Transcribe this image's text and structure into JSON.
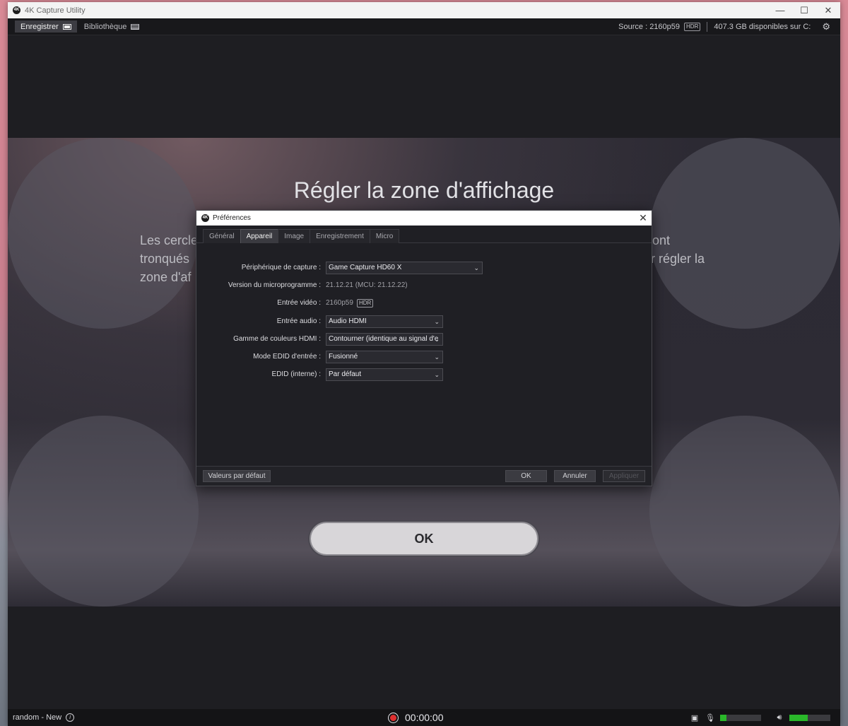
{
  "window": {
    "title": "4K Capture Utility",
    "logo_text": "4K",
    "controls": {
      "minimize": "—",
      "maximize": "☐",
      "close": "✕"
    }
  },
  "topbar": {
    "tabs": [
      {
        "label": "Enregistrer",
        "icon": "record-screen-icon",
        "active": true
      },
      {
        "label": "Bibliothèque",
        "icon": "library-grid-icon",
        "active": false
      }
    ],
    "source_label": "Source : 2160p59",
    "hdr_badge": "HDR",
    "storage": "407.3 GB disponibles sur C:",
    "settings_icon": "gear-icon"
  },
  "preview": {
    "title": "Régler la zone d'affichage",
    "left_text": [
      "Les cercle",
      "tronqués",
      "zone d'af"
    ],
    "right_text": [
      "ont",
      "r régler la"
    ],
    "ok_label": "OK"
  },
  "dialog": {
    "title": "Préférences",
    "logo_text": "4K",
    "close": "✕",
    "tabs": [
      {
        "label": "Général",
        "active": false
      },
      {
        "label": "Appareil",
        "active": true
      },
      {
        "label": "Image",
        "active": false
      },
      {
        "label": "Enregistrement",
        "active": false
      },
      {
        "label": "Micro",
        "active": false
      }
    ],
    "fields": {
      "capture_device": {
        "label": "Périphérique de capture :",
        "value": "Game Capture HD60 X"
      },
      "firmware": {
        "label": "Version du microprogramme :",
        "value": "21.12.21 (MCU: 21.12.22)"
      },
      "video_input": {
        "label": "Entrée vidéo :",
        "value": "2160p59",
        "badge": "HDR"
      },
      "audio_input": {
        "label": "Entrée audio :",
        "value": "Audio HDMI"
      },
      "hdmi_color": {
        "label": "Gamme de couleurs HDMI :",
        "value": "Contourner (identique au signal d'e"
      },
      "edid_mode": {
        "label": "Mode EDID d'entrée :",
        "value": "Fusionné"
      },
      "edid_internal": {
        "label": "EDID (interne) :",
        "value": "Par défaut"
      }
    },
    "footer": {
      "defaults": "Valeurs par défaut",
      "ok": "OK",
      "cancel": "Annuler",
      "apply": "Appliquer"
    }
  },
  "statusbar": {
    "profile": "random - New",
    "timer": "00:00:00",
    "mic_level": 0.15,
    "volume_level": 0.45,
    "colors": {
      "meter_green": "#2ab82a",
      "record_red": "#e03030"
    }
  }
}
